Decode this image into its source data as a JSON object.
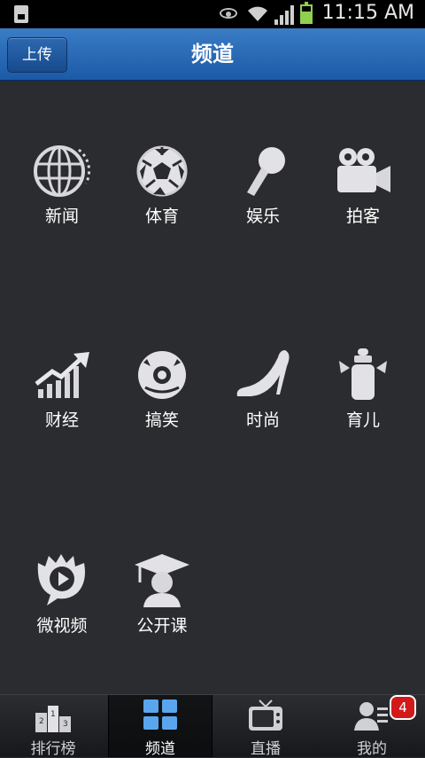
{
  "status_bar": {
    "time": "11:15 AM"
  },
  "header": {
    "upload_label": "上传",
    "title": "频道"
  },
  "channels": [
    {
      "label": "新闻",
      "icon": "globe-icon"
    },
    {
      "label": "体育",
      "icon": "soccer-ball-icon"
    },
    {
      "label": "娱乐",
      "icon": "microphone-icon"
    },
    {
      "label": "拍客",
      "icon": "video-camera-icon"
    },
    {
      "label": "财经",
      "icon": "rising-chart-icon"
    },
    {
      "label": "搞笑",
      "icon": "clown-face-icon"
    },
    {
      "label": "时尚",
      "icon": "high-heel-icon"
    },
    {
      "label": "育儿",
      "icon": "baby-bottle-icon"
    },
    {
      "label": "微视频",
      "icon": "play-bubble-icon"
    },
    {
      "label": "公开课",
      "icon": "graduate-icon"
    }
  ],
  "tabs": [
    {
      "label": "排行榜",
      "icon": "podium-icon"
    },
    {
      "label": "频道",
      "icon": "grid-icon",
      "active": true
    },
    {
      "label": "直播",
      "icon": "tv-icon"
    },
    {
      "label": "我的",
      "icon": "user-icon",
      "badge": "4"
    }
  ],
  "colors": {
    "accent": "#2a6fbe",
    "badge": "#d21a1a",
    "icon_gray": "#d8d8dc"
  }
}
